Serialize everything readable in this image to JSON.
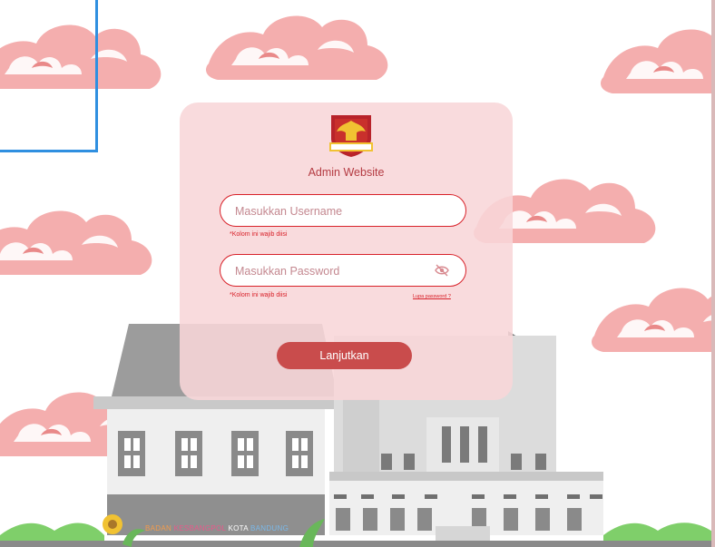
{
  "card": {
    "title": "Admin Website",
    "username": {
      "placeholder": "Masukkan Username",
      "error": "*Kolom ini wajib diisi"
    },
    "password": {
      "placeholder": "Masukkan Password",
      "error": "*Kolom ini wajib diisi",
      "forgot_label": "Lupa password ?"
    },
    "submit_label": "Lanjutkan"
  },
  "footer": {
    "tagline_parts": [
      "BADAN",
      "KESBANGPOL",
      "KOTA",
      "BANDUNG"
    ]
  },
  "colors": {
    "accent": "#c94c4c",
    "error": "#d8222a",
    "card_bg": "#f8d6d8",
    "cloud": "#f2a6a6"
  },
  "icons": {
    "password_toggle": "eye-off-icon",
    "logo": "garuda-emblem"
  }
}
